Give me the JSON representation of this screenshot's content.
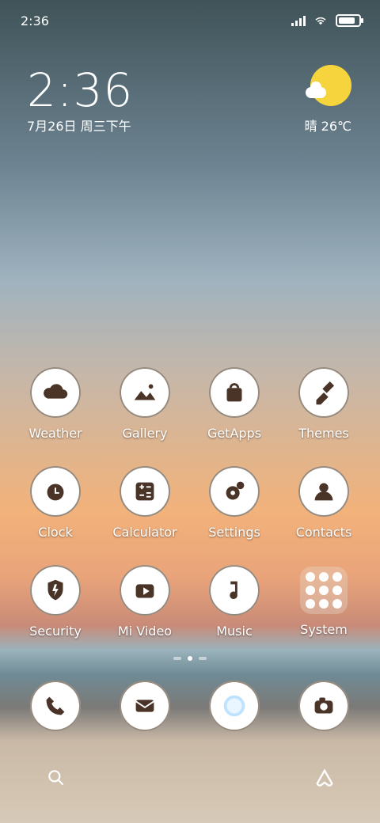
{
  "status": {
    "time": "2:36"
  },
  "clock": {
    "time": "2:36",
    "date": "7月26日 周三下午"
  },
  "weather": {
    "text": "晴 26℃"
  },
  "apps": [
    {
      "label": "Weather",
      "icon": "weather-icon"
    },
    {
      "label": "Gallery",
      "icon": "gallery-icon"
    },
    {
      "label": "GetApps",
      "icon": "getapps-icon"
    },
    {
      "label": "Themes",
      "icon": "themes-icon"
    },
    {
      "label": "Clock",
      "icon": "clock-icon"
    },
    {
      "label": "Calculator",
      "icon": "calculator-icon"
    },
    {
      "label": "Settings",
      "icon": "settings-icon"
    },
    {
      "label": "Contacts",
      "icon": "contacts-icon"
    },
    {
      "label": "Security",
      "icon": "security-icon"
    },
    {
      "label": "Mi Video",
      "icon": "mi-video-icon"
    },
    {
      "label": "Music",
      "icon": "music-icon"
    },
    {
      "label": "System",
      "icon": "system-folder-icon"
    }
  ],
  "dock": [
    {
      "icon": "phone-icon"
    },
    {
      "icon": "mail-icon"
    },
    {
      "icon": "browser-icon"
    },
    {
      "icon": "camera-icon"
    }
  ],
  "bottom": {
    "left_icon": "search-icon",
    "right_icon": "assistant-icon"
  }
}
